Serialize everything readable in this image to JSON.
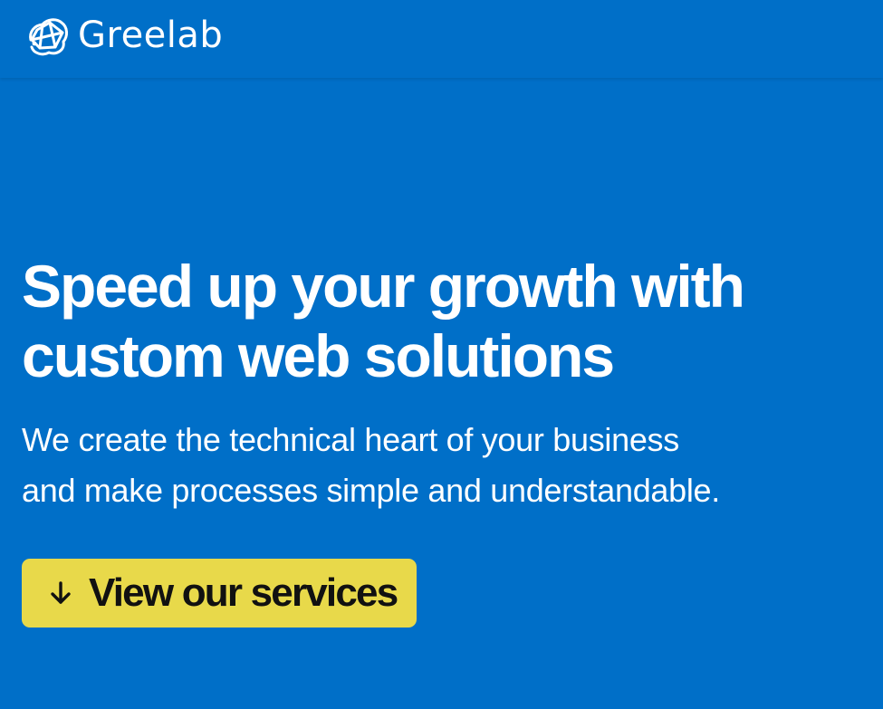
{
  "header": {
    "logo": {
      "icon": "greelab-logo-mark",
      "text": "Greelab"
    }
  },
  "hero": {
    "title_lines": [
      "Speed up your growth with",
      "custom web solutions"
    ],
    "subtitle_lines": [
      "We create the technical heart of your business",
      "and make processes simple and understandable."
    ],
    "cta": {
      "icon": "arrow-down-icon",
      "label": "View our services"
    }
  },
  "colors": {
    "background": "#006fc8",
    "text": "#ffffff",
    "cta_background": "#e8d94a",
    "cta_text": "#111111"
  }
}
